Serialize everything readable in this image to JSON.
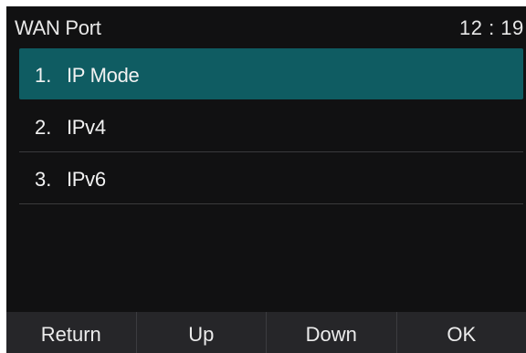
{
  "status_bar": {
    "title": "WAN Port",
    "time": "12 : 19"
  },
  "menu": {
    "items": [
      {
        "number": "1.",
        "label": "IP Mode"
      },
      {
        "number": "2.",
        "label": "IPv4"
      },
      {
        "number": "3.",
        "label": "IPv6"
      }
    ]
  },
  "softkeys": {
    "return_label": "Return",
    "up_label": "Up",
    "down_label": "Down",
    "ok_label": "OK"
  },
  "colors": {
    "screen_background": "#111112",
    "selection_highlight": "#0f5c62",
    "softkey_bar": "#262629"
  }
}
